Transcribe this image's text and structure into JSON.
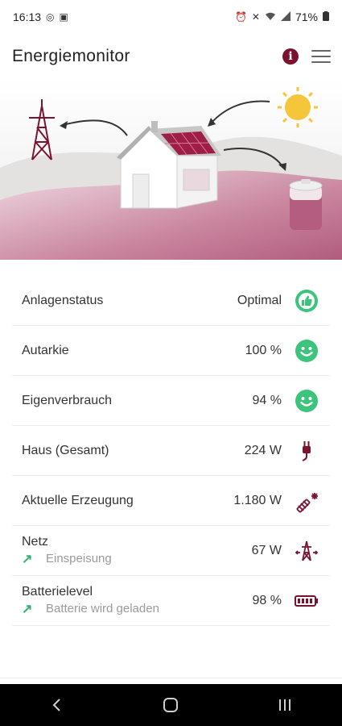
{
  "status_bar": {
    "time": "16:13",
    "battery": "71%",
    "icons": [
      "data-saver-icon",
      "lock-icon",
      "alarm-icon",
      "mute-icon",
      "wifi-icon",
      "signal-icon",
      "battery-icon"
    ]
  },
  "app": {
    "title": "Energiemonitor"
  },
  "colors": {
    "accent": "#7a1230",
    "positive": "#3cc47c",
    "hero_ground": "#c56f8f"
  },
  "list": [
    {
      "label": "Anlagenstatus",
      "value": "Optimal",
      "icon": "thumbs-up-icon"
    },
    {
      "label": "Autarkie",
      "value": "100 %",
      "icon": "smiley-icon"
    },
    {
      "label": "Eigenverbrauch",
      "value": "94 %",
      "icon": "smiley-icon"
    },
    {
      "label": "Haus (Gesamt)",
      "value": "224 W",
      "icon": "plug-icon"
    },
    {
      "label": "Aktuelle Erzeugung",
      "value": "1.180 W",
      "icon": "solar-panel-icon"
    },
    {
      "label": "Netz",
      "sub": "Einspeisung",
      "sub_icon": "arrow-up-right-icon",
      "value": "67 W",
      "icon": "power-tower-icon"
    },
    {
      "label": "Batterielevel",
      "sub": "Batterie wird geladen",
      "sub_icon": "arrow-up-right-icon",
      "value": "98 %",
      "icon": "battery-charging-icon"
    }
  ],
  "nav": [
    "back-icon",
    "home-icon",
    "recents-icon"
  ]
}
